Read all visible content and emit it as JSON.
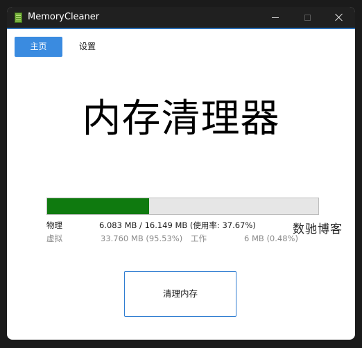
{
  "window": {
    "title": "MemoryCleaner",
    "accent_color": "#2c6fb6"
  },
  "tabs": [
    {
      "label": "主页",
      "active": true
    },
    {
      "label": "设置",
      "active": false
    }
  ],
  "main": {
    "heading": "内存清理器",
    "usage_fraction": 0.3767,
    "bar_color": "#0f7a0f",
    "physical": {
      "label": "物理",
      "value": "6.083 MB / 16.149 MB (使用率: 37.67%)"
    },
    "virtual": {
      "label": "虚拟",
      "value": "33.760 MB (95.53%)",
      "working_label": "工作",
      "working_value": "6 MB (0.48%)"
    },
    "clean_button_label": "清理内存"
  },
  "watermark": "数驰博客"
}
